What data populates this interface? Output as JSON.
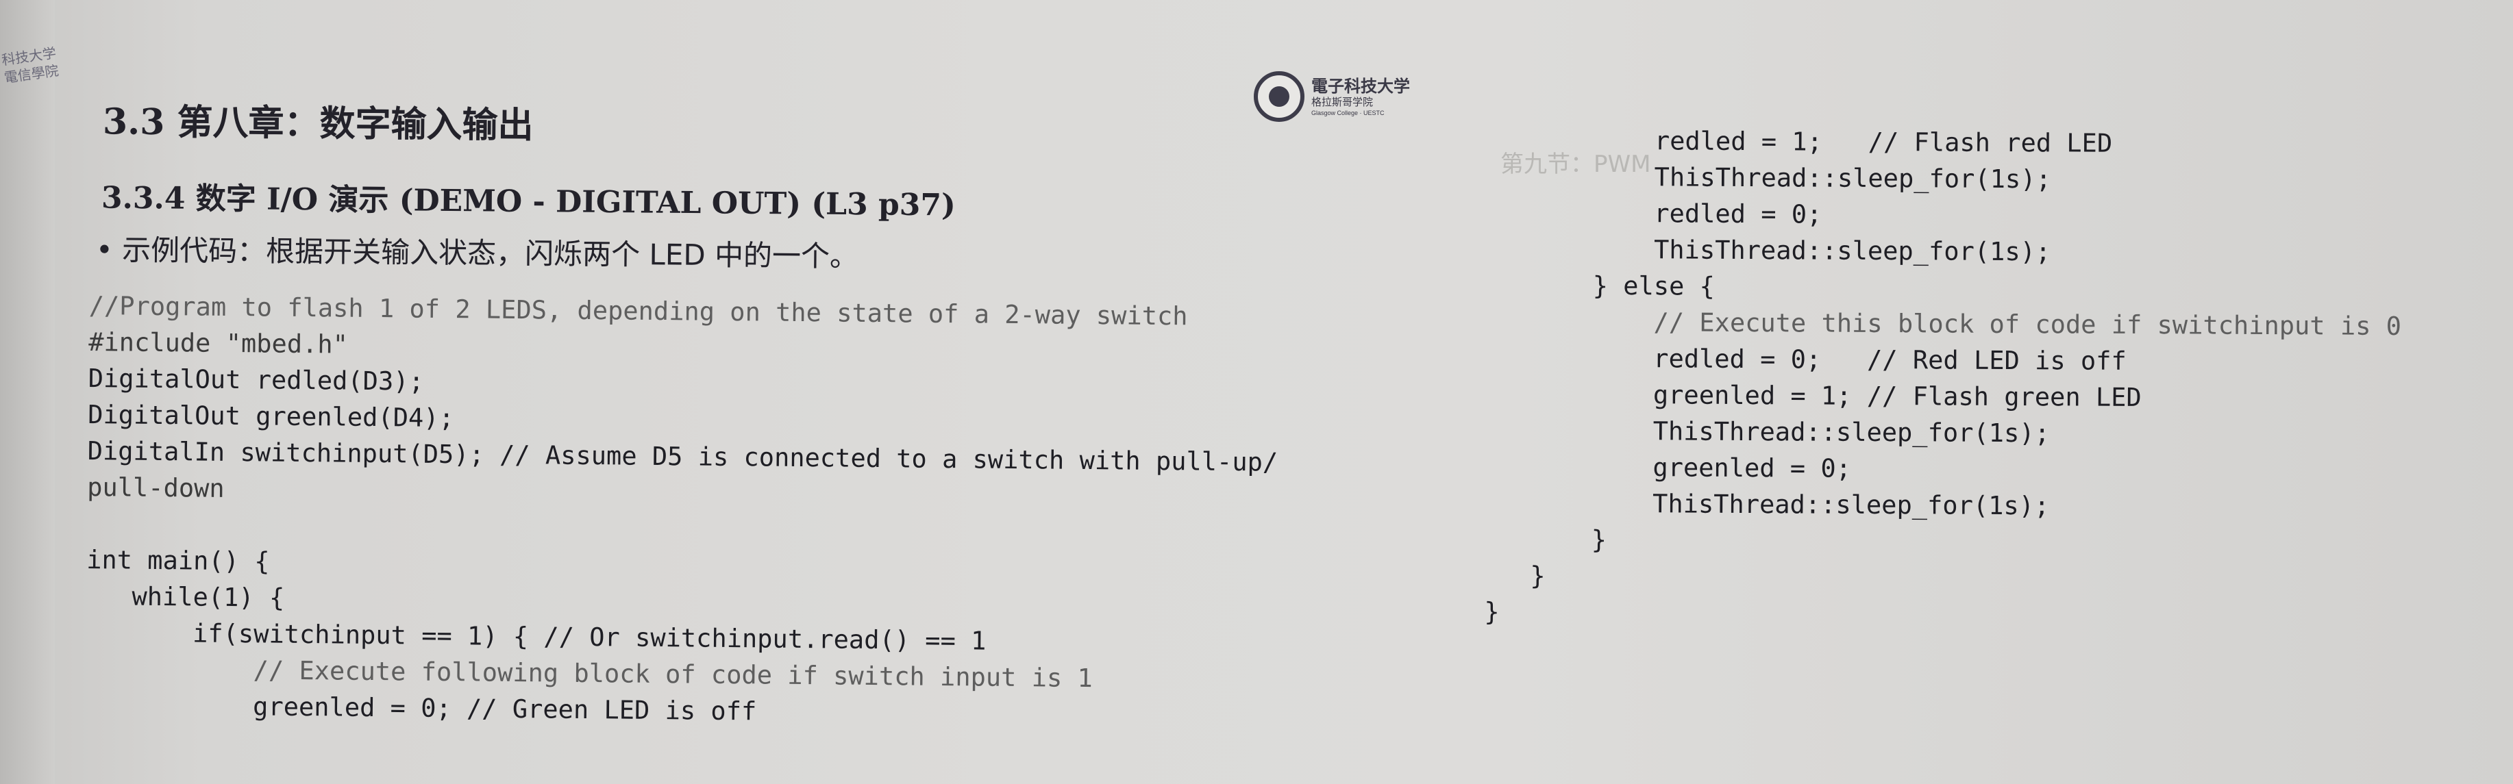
{
  "margin_text": "科技大学\n電信學院",
  "logo": {
    "name": "電子科技大学",
    "subtitle": "格拉斯哥学院",
    "english": "Glasgow College · UESTC"
  },
  "heading": {
    "section": "3.3 第八章：数字输入输出",
    "subsection": "3.3.4 数字 I/O 演示 (DEMO - DIGITAL OUT) (L3 p37)",
    "bullet": "• 示例代码：根据开关输入状态，闪烁两个 LED 中的一个。"
  },
  "code_left": [
    "//Program to flash 1 of 2 LEDS, depending on the state of a 2-way switch",
    "#include \"mbed.h\"",
    "DigitalOut redled(D3);",
    "DigitalOut greenled(D4);",
    "DigitalIn switchinput(D5); // Assume D5 is connected to a switch with pull-up/",
    "pull-down",
    "",
    "int main() {",
    "   while(1) {",
    "       if(switchinput == 1) { // Or switchinput.read() == 1",
    "           // Execute following block of code if switch input is 1",
    "           greenled = 0; // Green LED is off"
  ],
  "code_right": [
    "           redled = 1;   // Flash red LED",
    "           ThisThread::sleep_for(1s);",
    "           redled = 0;",
    "           ThisThread::sleep_for(1s);",
    "       } else {",
    "           // Execute this block of code if switchinput is 0",
    "           redled = 0;   // Red LED is off",
    "           greenled = 1; // Flash green LED",
    "           ThisThread::sleep_for(1s);",
    "           greenled = 0;",
    "           ThisThread::sleep_for(1s);",
    "       }",
    "   }",
    "}"
  ],
  "bleed_through": "第九节：PWM"
}
